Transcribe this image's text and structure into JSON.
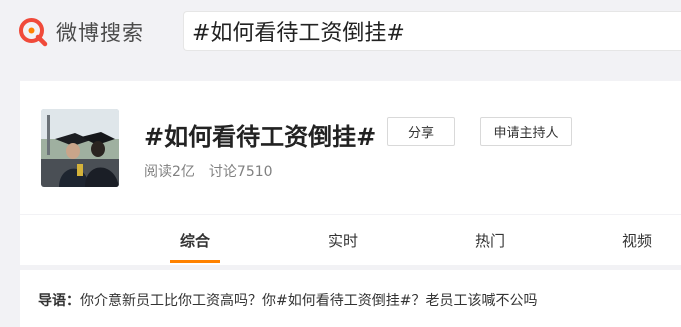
{
  "brand": {
    "logo_icon": "weibo-search-logo-icon",
    "name": "微博搜索",
    "accent": "#ff8200"
  },
  "search": {
    "value": "#如何看待工资倒挂#"
  },
  "topic": {
    "title": "#如何看待工资倒挂#",
    "share_label": "分享",
    "host_label": "申请主持人",
    "reads": "阅读2亿",
    "discussions": "讨论7510"
  },
  "tabs": [
    {
      "label": "综合",
      "active": true
    },
    {
      "label": "实时",
      "active": false
    },
    {
      "label": "热门",
      "active": false
    },
    {
      "label": "视频",
      "active": false
    }
  ],
  "guide": {
    "label": "导语：",
    "text": "你介意新员工比你工资高吗？你#如何看待工资倒挂#？老员工该喊不公吗"
  }
}
